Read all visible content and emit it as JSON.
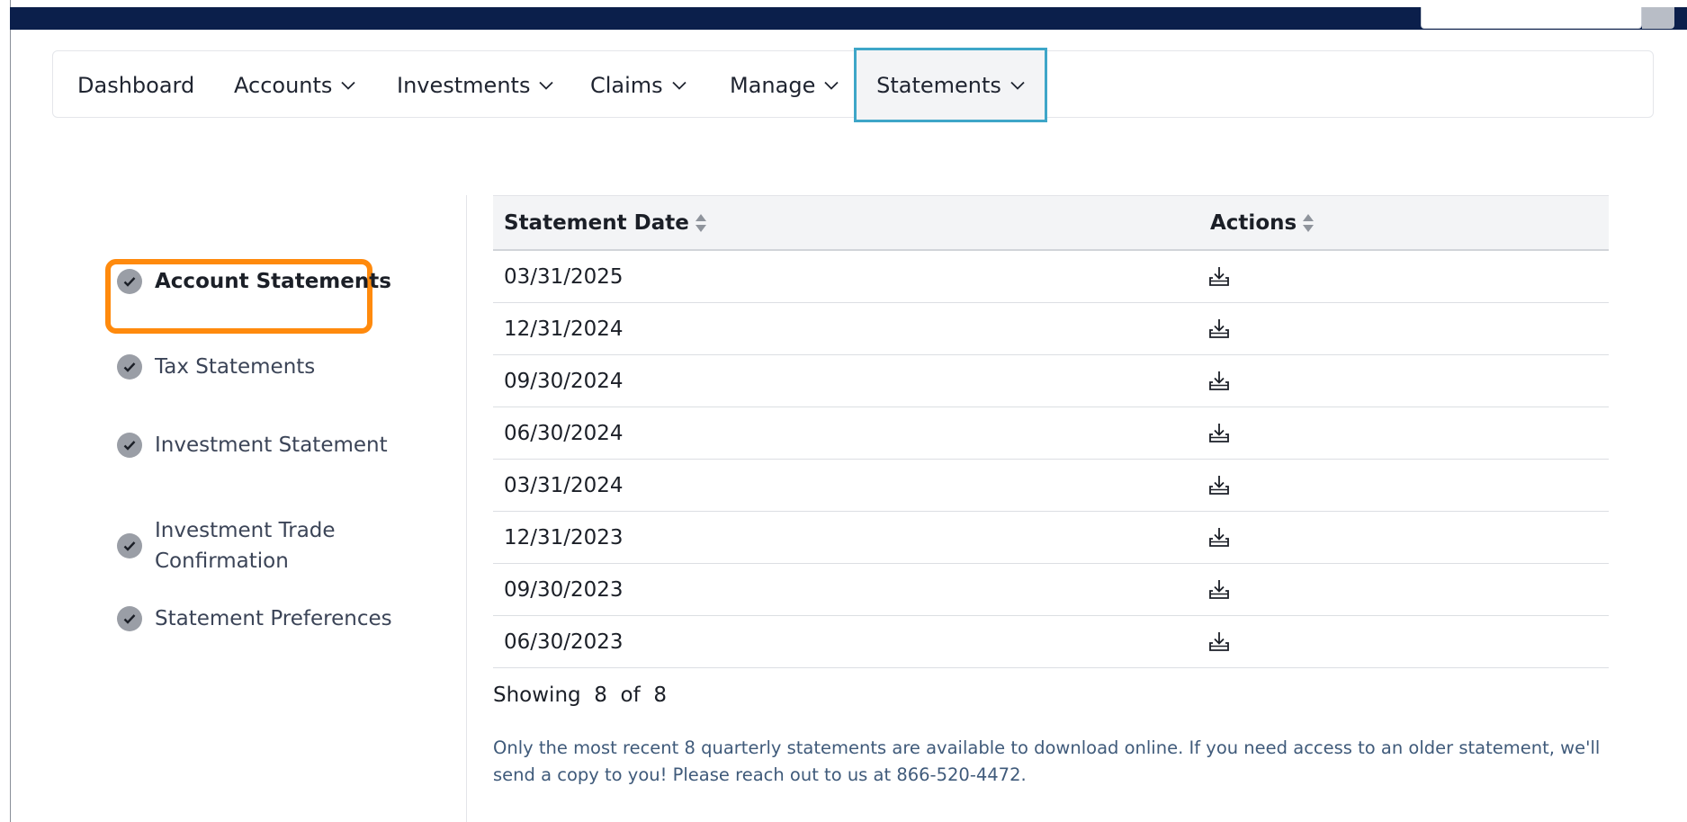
{
  "nav": {
    "items": [
      {
        "label": "Dashboard",
        "has_dropdown": false
      },
      {
        "label": "Accounts",
        "has_dropdown": true
      },
      {
        "label": "Investments",
        "has_dropdown": true
      },
      {
        "label": "Claims",
        "has_dropdown": true
      },
      {
        "label": "Manage",
        "has_dropdown": true
      },
      {
        "label": "Statements",
        "has_dropdown": true,
        "active": true
      }
    ]
  },
  "sidebar": {
    "items": [
      {
        "label": "Account Statements",
        "active": true
      },
      {
        "label": "Tax Statements"
      },
      {
        "label": "Investment Statement"
      },
      {
        "label": "Investment Trade Confirmation",
        "line1": "Investment Trade",
        "line2": "Confirmation"
      },
      {
        "label": "Statement Preferences"
      }
    ]
  },
  "table": {
    "headers": [
      "Statement Date",
      "Actions"
    ],
    "rows": [
      {
        "date": "03/31/2025",
        "action_icon": "download-icon"
      },
      {
        "date": "12/31/2024",
        "action_icon": "download-icon"
      },
      {
        "date": "09/30/2024",
        "action_icon": "download-icon"
      },
      {
        "date": "06/30/2024",
        "action_icon": "download-icon"
      },
      {
        "date": "03/31/2024",
        "action_icon": "download-icon"
      },
      {
        "date": "12/31/2023",
        "action_icon": "download-icon"
      },
      {
        "date": "09/30/2023",
        "action_icon": "download-icon"
      },
      {
        "date": "06/30/2023",
        "action_icon": "download-icon"
      }
    ]
  },
  "pagination": {
    "showing_label": "Showing",
    "shown": "8",
    "of_label": "of",
    "total": "8"
  },
  "note": "Only the most recent 8 quarterly statements are available to download online. If you need access to an older statement, we'll send a copy to you! Please reach out to us at 866-520-4472.",
  "colors": {
    "topbar": "#0b1f4b",
    "active_nav_border": "#3ea6c8",
    "active_sidebar_border": "#ff8a0d",
    "note_text": "#3f5a7a"
  }
}
